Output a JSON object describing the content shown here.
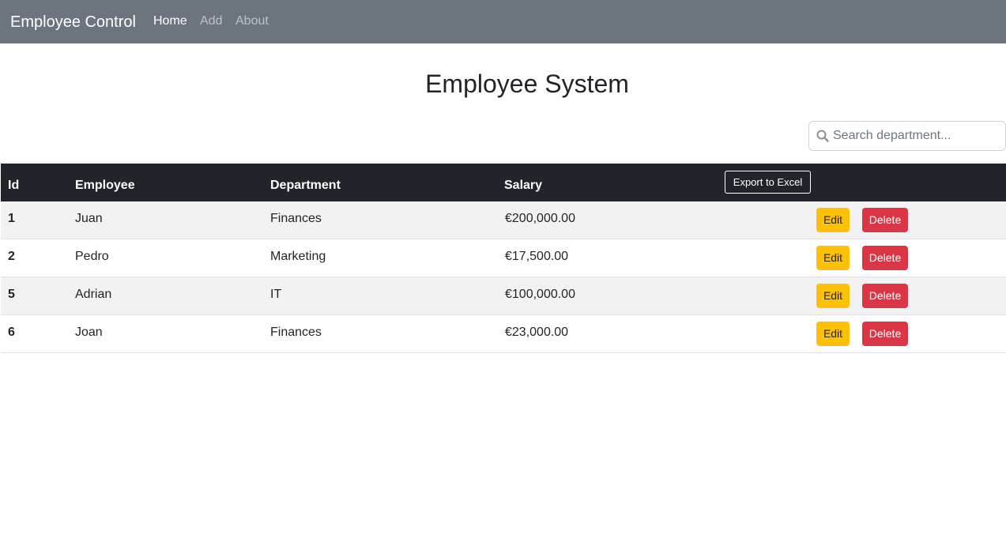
{
  "navbar": {
    "brand": "Employee Control",
    "links": [
      {
        "label": "Home",
        "active": true
      },
      {
        "label": "Add",
        "active": false
      },
      {
        "label": "About",
        "active": false
      }
    ]
  },
  "page": {
    "title": "Employee System"
  },
  "search": {
    "placeholder": "Search department...",
    "value": ""
  },
  "table": {
    "headers": {
      "id": "Id",
      "employee": "Employee",
      "department": "Department",
      "salary": "Salary"
    },
    "export_label": "Export to Excel",
    "edit_label": "Edit",
    "delete_label": "Delete",
    "rows": [
      {
        "id": "1",
        "employee": "Juan",
        "department": "Finances",
        "salary": "€200,000.00"
      },
      {
        "id": "2",
        "employee": "Pedro",
        "department": "Marketing",
        "salary": "€17,500.00"
      },
      {
        "id": "5",
        "employee": "Adrian",
        "department": "IT",
        "salary": "€100,000.00"
      },
      {
        "id": "6",
        "employee": "Joan",
        "department": "Finances",
        "salary": "€23,000.00"
      }
    ]
  },
  "colors": {
    "navbar": "#6c757d",
    "table_header": "#212529",
    "edit_button": "#ffc107",
    "delete_button": "#dc3545"
  }
}
